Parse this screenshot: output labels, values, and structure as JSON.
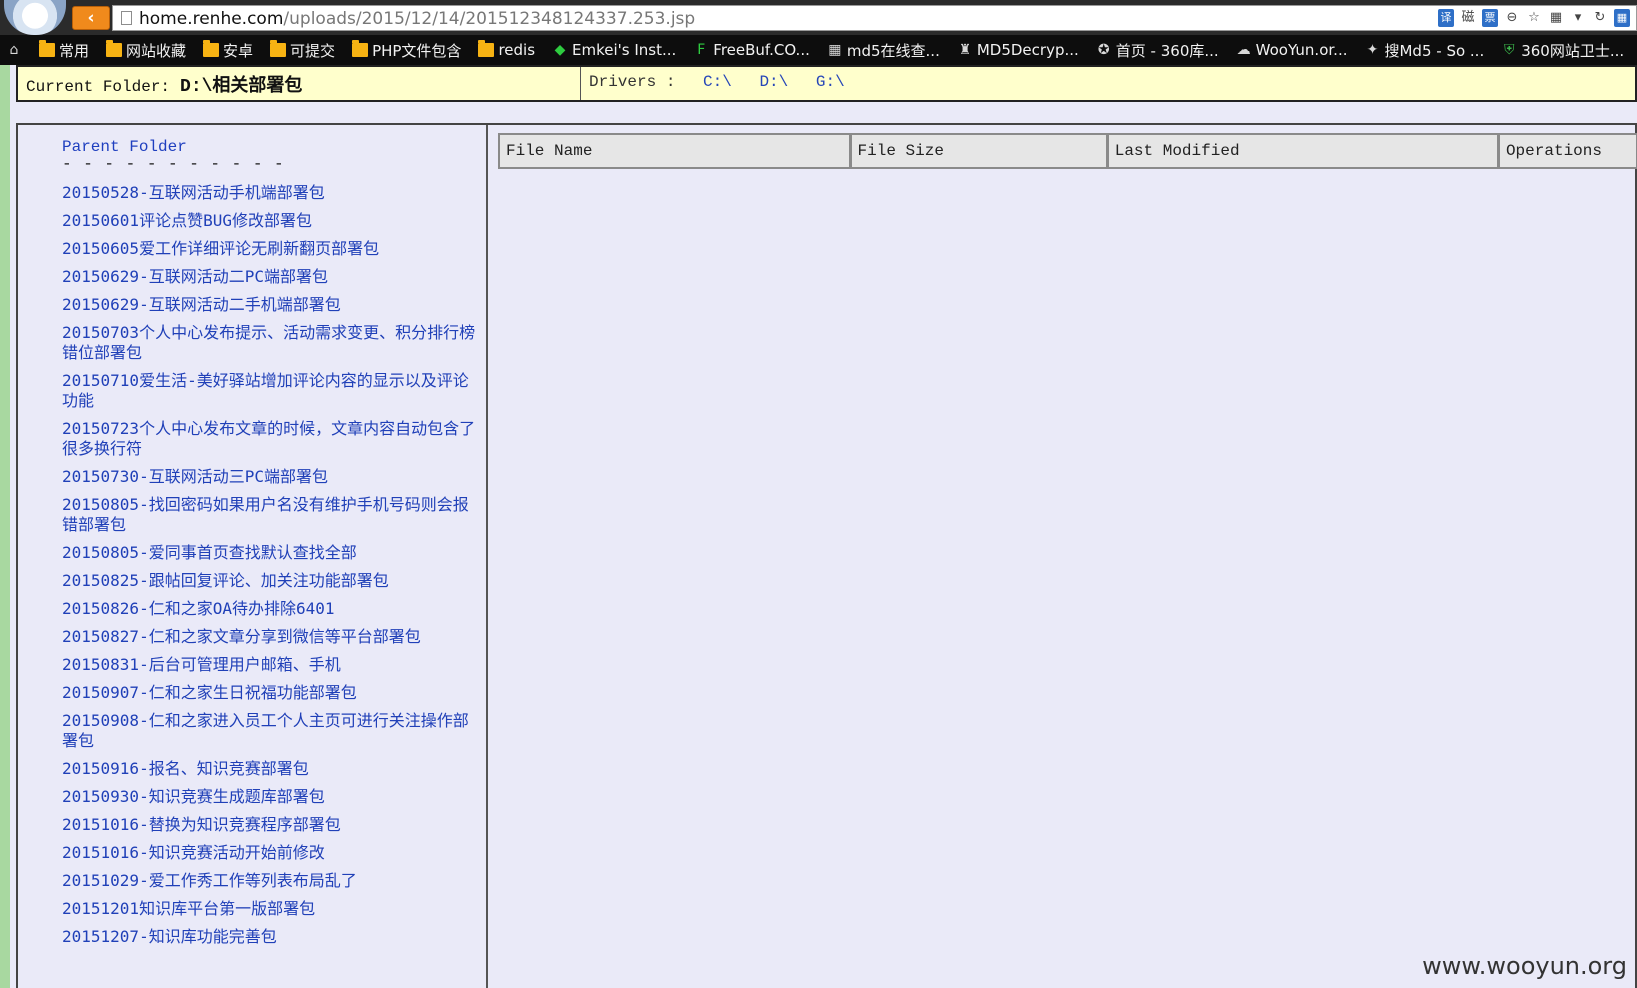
{
  "browser": {
    "url_host": "home.renhe.com",
    "url_path": "/uploads/2015/12/14/201512348124337.253.jsp",
    "back_label": "‹",
    "tools": [
      "译",
      "磁",
      "票",
      "⊖",
      "☆",
      "▦",
      "▾",
      "↻",
      "▦"
    ]
  },
  "bookmarks": [
    {
      "label": "常用",
      "icon": "folder-icon"
    },
    {
      "label": "网站收藏",
      "icon": "folder-icon"
    },
    {
      "label": "安卓",
      "icon": "folder-icon"
    },
    {
      "label": "可提交",
      "icon": "folder-icon"
    },
    {
      "label": "PHP文件包含",
      "icon": "folder-icon"
    },
    {
      "label": "redis",
      "icon": "folder-icon"
    },
    {
      "label": "Emkei's Inst...",
      "icon": "green-shield-icon"
    },
    {
      "label": "FreeBuf.CO...",
      "icon": "freebuf-icon"
    },
    {
      "label": "md5在线查...",
      "icon": "grid-icon"
    },
    {
      "label": "MD5Decryp...",
      "icon": "md5decrypt-icon"
    },
    {
      "label": "首页 - 360库...",
      "icon": "star-icon"
    },
    {
      "label": "WooYun.or...",
      "icon": "wooyun-icon"
    },
    {
      "label": "搜Md5 - So ...",
      "icon": "md5-icon"
    },
    {
      "label": "360网站卫士...",
      "icon": "shield-icon"
    }
  ],
  "info_bar": {
    "current_label": "Current Folder:",
    "current_path": "D:\\相关部署包",
    "drivers_label": "Drivers :",
    "drivers": [
      "C:\\",
      "D:\\",
      "G:\\"
    ]
  },
  "folder_panel": {
    "parent_label": "Parent Folder",
    "divider": "- - - - - - - - - - -",
    "items": [
      "20150528-互联网活动手机端部署包",
      "20150601评论点赞BUG修改部署包",
      "20150605爱工作详细评论无刷新翻页部署包",
      "20150629-互联网活动二PC端部署包",
      "20150629-互联网活动二手机端部署包",
      "20150703个人中心发布提示、活动需求变更、积分排行榜错位部署包",
      "20150710爱生活-美好驿站增加评论内容的显示以及评论功能",
      "20150723个人中心发布文章的时候，文章内容自动包含了很多换行符",
      "20150730-互联网活动三PC端部署包",
      "20150805-找回密码如果用户名没有维护手机号码则会报错部署包",
      "20150805-爱同事首页查找默认查找全部",
      "20150825-跟帖回复评论、加关注功能部署包",
      "20150826-仁和之家OA待办排除6401",
      "20150827-仁和之家文章分享到微信等平台部署包",
      "20150831-后台可管理用户邮箱、手机",
      "20150907-仁和之家生日祝福功能部署包",
      "20150908-仁和之家进入员工个人主页可进行关注操作部署包",
      "20150916-报名、知识竞赛部署包",
      "20150930-知识竞赛生成题库部署包",
      "20151016-替换为知识竞赛程序部署包",
      "20151016-知识竞赛活动开始前修改",
      "20151029-爱工作秀工作等列表布局乱了",
      "20151201知识库平台第一版部署包",
      "20151207-知识库功能完善包"
    ]
  },
  "files_table": {
    "headers": [
      "File Name",
      "File Size",
      "Last Modified",
      "Operations"
    ]
  },
  "watermark": "www.wooyun.org"
}
